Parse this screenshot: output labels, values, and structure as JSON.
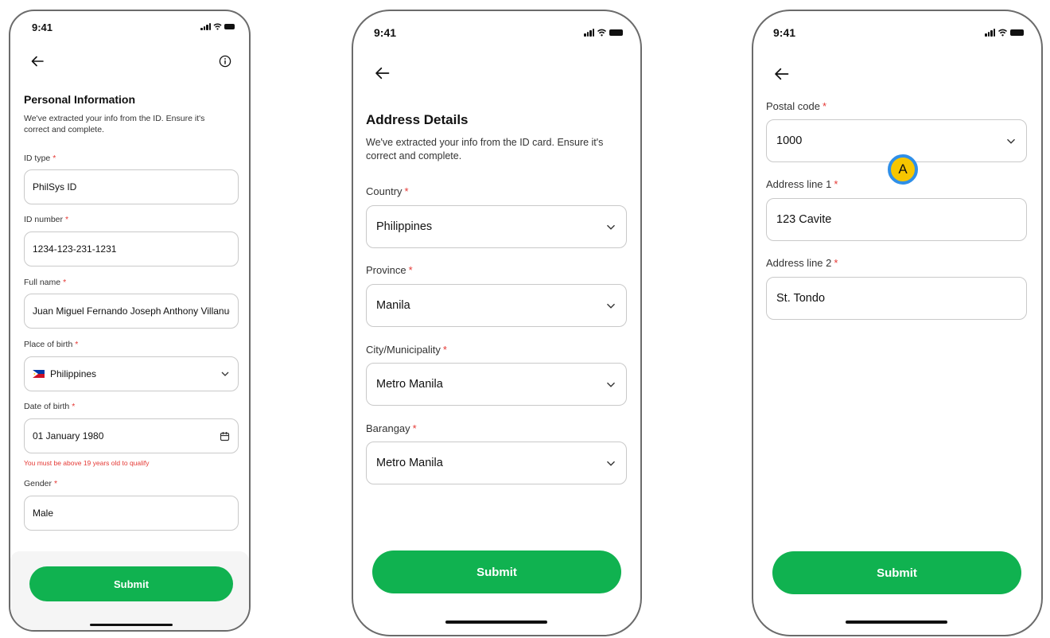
{
  "status_bar": {
    "time": "9:41"
  },
  "screen1": {
    "title": "Personal Information",
    "description": "We've extracted your info from the ID. Ensure it's correct and complete.",
    "fields": {
      "id_type": {
        "label": "ID type",
        "value": "PhilSys ID"
      },
      "id_number": {
        "label": "ID number",
        "value": "1234-123-231-1231"
      },
      "full_name": {
        "label": "Full name",
        "value": "Juan Miguel Fernando Joseph Anthony Villanueva"
      },
      "place_of_birth": {
        "label": "Place of birth",
        "value": "Philippines"
      },
      "date_of_birth": {
        "label": "Date of birth",
        "value": "01 January 1980",
        "error": "You must be above 19 years old to qualify"
      },
      "gender": {
        "label": "Gender",
        "value": "Male"
      }
    },
    "submit_label": "Submit"
  },
  "screen2": {
    "title": "Address Details",
    "description": "We've extracted your info from the ID card. Ensure it's correct and complete.",
    "fields": {
      "country": {
        "label": "Country",
        "value": "Philippines"
      },
      "province": {
        "label": "Province",
        "value": "Manila"
      },
      "city": {
        "label": "City/Municipality",
        "value": "Metro Manila"
      },
      "barangay": {
        "label": "Barangay",
        "value": "Metro Manila"
      }
    },
    "submit_label": "Submit"
  },
  "screen3": {
    "fields": {
      "postal_code": {
        "label": "Postal code",
        "value": "1000"
      },
      "address_line_1": {
        "label": "Address line 1",
        "value": "123 Cavite"
      },
      "address_line_2": {
        "label": "Address line 2",
        "value": "St. Tondo"
      }
    },
    "submit_label": "Submit",
    "annotation_marker": "A"
  },
  "colors": {
    "accent": "#10b250",
    "error": "#e53935",
    "marker_fill": "#f7c600",
    "marker_border": "#2f8fe8"
  },
  "icons": [
    "back-arrow-icon",
    "info-icon",
    "chevron-down-icon",
    "calendar-icon",
    "ph-flag-icon",
    "signal-icon",
    "wifi-icon",
    "battery-icon"
  ]
}
